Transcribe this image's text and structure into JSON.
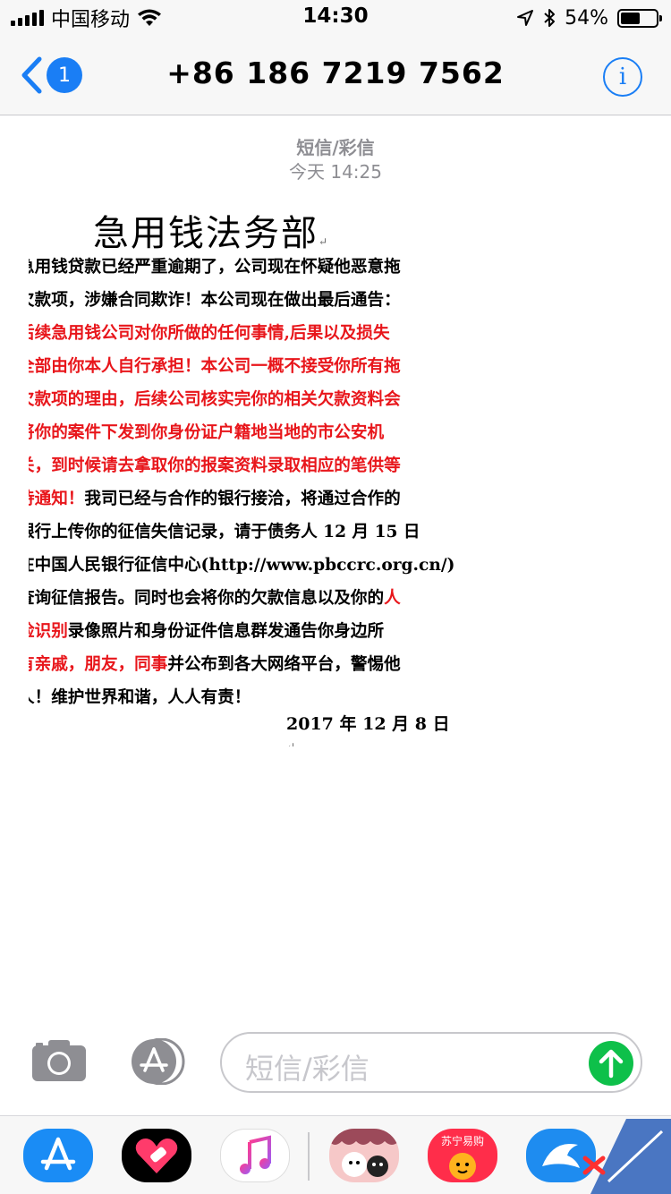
{
  "status_bar": {
    "carrier": "中国移动",
    "time": "14:30",
    "battery": "54%",
    "battery_level": 0.54
  },
  "nav": {
    "back_badge": "1",
    "title": "+86 186 7219 7562"
  },
  "message": {
    "type": "短信/彩信",
    "time": "今天 14:25"
  },
  "document": {
    "title": "急用钱法务部",
    "lines": [
      {
        "segments": [
          {
            "text": "急用钱贷款已经严重逾期了，公司现在怀疑他恶意拖",
            "red": false
          }
        ]
      },
      {
        "segments": [
          {
            "text": "欠款项，涉嫌合同欺诈！本公司现在做出最后通告：",
            "red": false
          }
        ]
      },
      {
        "segments": [
          {
            "text": "后续急用钱公司对你所做的任何事情,后果以及损失",
            "red": true
          }
        ]
      },
      {
        "segments": [
          {
            "text": "全部由你本人自行承担！本公司一概不接受你所有拖",
            "red": true
          }
        ]
      },
      {
        "segments": [
          {
            "text": "欠款项的理由，后续公司核实完你的相关欠款资料会",
            "red": true
          }
        ]
      },
      {
        "segments": [
          {
            "text": "将你的案件下发到你身份证户籍地当地的市公安机",
            "red": true
          }
        ]
      },
      {
        "segments": [
          {
            "text": "关，到时候请去拿取你的报案资料录取相应的笔供等",
            "red": true
          }
        ]
      },
      {
        "segments": [
          {
            "text": "待通知！",
            "red": true
          },
          {
            "text": "我司已经与合作的银行接洽，将通过合作的",
            "red": false
          }
        ]
      },
      {
        "segments": [
          {
            "text": "银行上传你的征信失信记录，请于债务人 12 月 15 日",
            "red": false
          }
        ]
      },
      {
        "segments": [
          {
            "text": "在中国人民银行征信中心(http://www.pbccrc.org.cn/)",
            "red": false
          }
        ]
      },
      {
        "segments": [
          {
            "text": "查询征信报告。同时也会将你的欠款信息以及你的",
            "red": false
          },
          {
            "text": "人",
            "red": true
          }
        ]
      },
      {
        "segments": [
          {
            "text": "脸识别",
            "red": true
          },
          {
            "text": "录像照片和身份证件信息群发通告你身边所",
            "red": false
          }
        ]
      },
      {
        "segments": [
          {
            "text": "有亲戚，朋友，同事",
            "red": true
          },
          {
            "text": "并公布到各大网络平台，警惕他",
            "red": false
          }
        ]
      },
      {
        "segments": [
          {
            "text": "人！维护世界和谐，人人有责！",
            "red": false
          }
        ]
      }
    ],
    "date": "2017 年 12 月 8 日"
  },
  "input": {
    "placeholder": "短信/彩信"
  },
  "drawer": {
    "apps": [
      {
        "name": "app-store",
        "label": "苏宁易购"
      }
    ]
  },
  "colors": {
    "accent": "#1a7ef5",
    "send": "#0ec04a",
    "alert_red": "#e8161b"
  }
}
